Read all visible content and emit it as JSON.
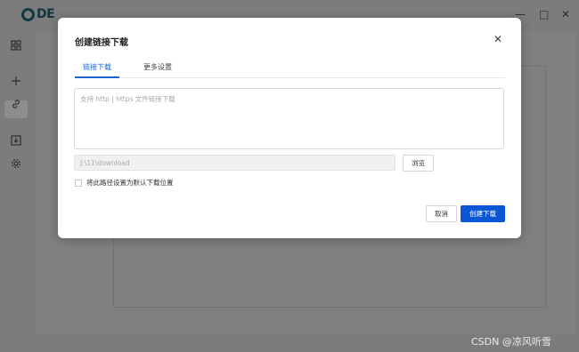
{
  "app": {
    "logo_text": "DE",
    "window": {
      "minimize": "—",
      "maximize": "□",
      "close": "✕"
    },
    "sidebar_icons": [
      "dashboard-icon",
      "plus-icon",
      "link-icon",
      "download-icon",
      "gear-icon"
    ]
  },
  "dialog": {
    "title": "创建链接下载",
    "close_glyph": "✕",
    "tabs": [
      {
        "label": "链接下载",
        "active": true
      },
      {
        "label": "更多设置",
        "active": false
      }
    ],
    "url_input": {
      "value": "",
      "placeholder": "支持 http | https 文件链接下载"
    },
    "path_input": {
      "value": "J:\\11\\download"
    },
    "browse_label": "浏览",
    "checkbox": {
      "label": "将此路径设置为默认下载位置",
      "checked": false
    },
    "cancel_label": "取消",
    "confirm_label": "创建下载"
  },
  "watermark": "CSDN @凉风听雪",
  "colors": {
    "accent": "#0b56d4",
    "tab_active": "#1b63d6",
    "overlay": "#7b7b7b"
  }
}
